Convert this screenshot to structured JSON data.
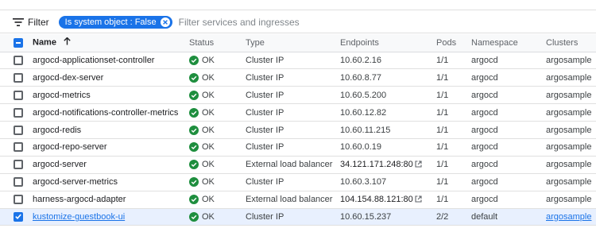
{
  "filter": {
    "label": "Filter",
    "chip_label": "Is system object : False",
    "placeholder": "Filter services and ingresses"
  },
  "columns": {
    "name": "Name",
    "status": "Status",
    "type": "Type",
    "endpoints": "Endpoints",
    "pods": "Pods",
    "namespace": "Namespace",
    "clusters": "Clusters"
  },
  "colors": {
    "accent": "#1a73e8",
    "ok": "#1e8e3e",
    "selected_row": "#e8f0fe"
  },
  "rows": [
    {
      "name": "argocd-applicationset-controller",
      "status": "OK",
      "type": "Cluster IP",
      "endpoint": "10.60.2.16",
      "external": false,
      "pods": "1/1",
      "namespace": "argocd",
      "cluster": "argosample",
      "selected": false
    },
    {
      "name": "argocd-dex-server",
      "status": "OK",
      "type": "Cluster IP",
      "endpoint": "10.60.8.77",
      "external": false,
      "pods": "1/1",
      "namespace": "argocd",
      "cluster": "argosample",
      "selected": false
    },
    {
      "name": "argocd-metrics",
      "status": "OK",
      "type": "Cluster IP",
      "endpoint": "10.60.5.200",
      "external": false,
      "pods": "1/1",
      "namespace": "argocd",
      "cluster": "argosample",
      "selected": false
    },
    {
      "name": "argocd-notifications-controller-metrics",
      "status": "OK",
      "type": "Cluster IP",
      "endpoint": "10.60.12.82",
      "external": false,
      "pods": "1/1",
      "namespace": "argocd",
      "cluster": "argosample",
      "selected": false
    },
    {
      "name": "argocd-redis",
      "status": "OK",
      "type": "Cluster IP",
      "endpoint": "10.60.11.215",
      "external": false,
      "pods": "1/1",
      "namespace": "argocd",
      "cluster": "argosample",
      "selected": false
    },
    {
      "name": "argocd-repo-server",
      "status": "OK",
      "type": "Cluster IP",
      "endpoint": "10.60.0.19",
      "external": false,
      "pods": "1/1",
      "namespace": "argocd",
      "cluster": "argosample",
      "selected": false
    },
    {
      "name": "argocd-server",
      "status": "OK",
      "type": "External load balancer",
      "endpoint": "34.121.171.248:80",
      "external": true,
      "pods": "1/1",
      "namespace": "argocd",
      "cluster": "argosample",
      "selected": false
    },
    {
      "name": "argocd-server-metrics",
      "status": "OK",
      "type": "Cluster IP",
      "endpoint": "10.60.3.107",
      "external": false,
      "pods": "1/1",
      "namespace": "argocd",
      "cluster": "argosample",
      "selected": false
    },
    {
      "name": "harness-argocd-adapter",
      "status": "OK",
      "type": "External load balancer",
      "endpoint": "104.154.88.121:80",
      "external": true,
      "pods": "1/1",
      "namespace": "argocd",
      "cluster": "argosample",
      "selected": false
    },
    {
      "name": "kustomize-guestbook-ui",
      "status": "OK",
      "type": "Cluster IP",
      "endpoint": "10.60.15.237",
      "external": false,
      "pods": "2/2",
      "namespace": "default",
      "cluster": "argosample",
      "selected": true
    }
  ]
}
